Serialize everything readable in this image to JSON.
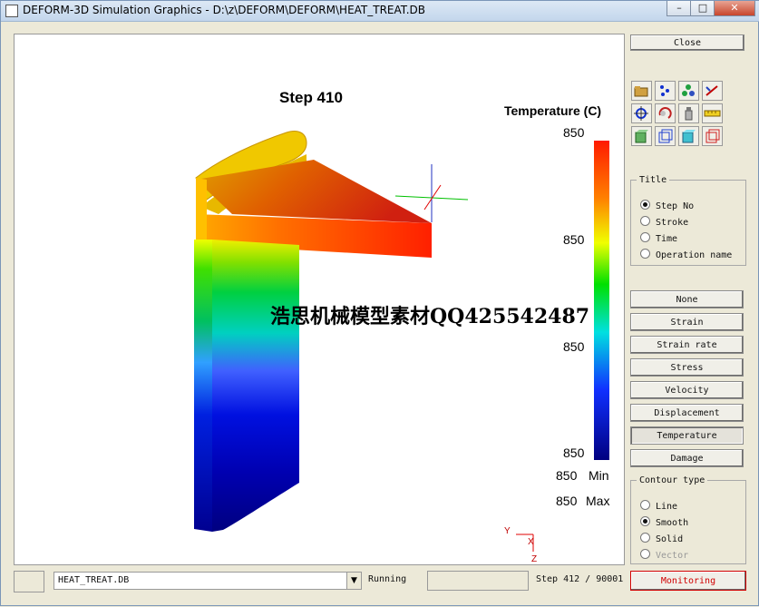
{
  "window": {
    "title": "DEFORM-3D Simulation Graphics - D:\\z\\DEFORM\\DEFORM\\HEAT_TREAT.DB",
    "minimize_glyph": "–",
    "maximize_glyph": "□",
    "close_glyph": "✕"
  },
  "viewport": {
    "step_label": "Step  410",
    "legend_title": "Temperature (C)",
    "scale_labels": [
      "850",
      "850",
      "850",
      "850"
    ],
    "min_value": "850",
    "min_label": "Min",
    "max_value": "850",
    "max_label": "Max",
    "watermark": "浩思机械模型素材QQ425542487",
    "axis_y": "Y",
    "axis_x": "X",
    "axis_z": "Z",
    "colors": {
      "hot": "#ff2000",
      "mid": "#00d040",
      "cold": "#000090"
    }
  },
  "panel": {
    "close_label": "Close",
    "tool_icons": [
      "open-folder-icon",
      "particles-icon",
      "molecule-icon",
      "measure-icon",
      "center-move-icon",
      "rotate-icon",
      "spray-icon",
      "ruler-icon",
      "solid-cube-icon",
      "wire-cube-icon",
      "shaded-cube-icon",
      "red-cube-icon"
    ],
    "title_group": {
      "legend": "Title",
      "options": [
        {
          "label": "Step No",
          "selected": true
        },
        {
          "label": "Stroke",
          "selected": false
        },
        {
          "label": "Time",
          "selected": false
        },
        {
          "label": "Operation name",
          "selected": false
        }
      ]
    },
    "variable_buttons": [
      "None",
      "Strain",
      "Strain rate",
      "Stress",
      "Velocity",
      "Displacement",
      "Temperature",
      "Damage"
    ],
    "active_variable": "Temperature",
    "contour_group": {
      "legend": "Contour type",
      "options": [
        {
          "label": "Line",
          "selected": false,
          "disabled": false
        },
        {
          "label": "Smooth",
          "selected": true,
          "disabled": false
        },
        {
          "label": "Solid",
          "selected": false,
          "disabled": false
        },
        {
          "label": "Vector",
          "selected": false,
          "disabled": true
        }
      ]
    }
  },
  "status": {
    "db_file": "HEAT_TREAT.DB",
    "state": "Running",
    "step_info": "Step 412 / 90001",
    "monitor_label": "Monitoring"
  }
}
